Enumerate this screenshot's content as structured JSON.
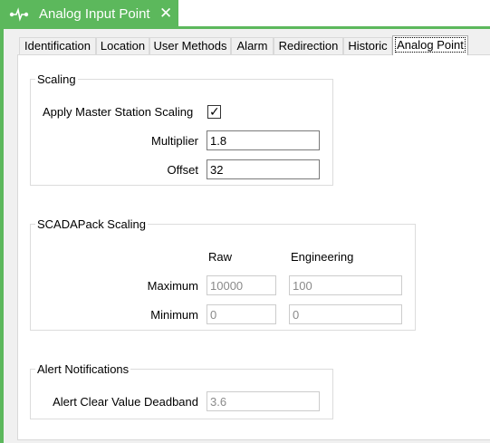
{
  "document_tab": {
    "title": "Analog Input Point",
    "close_glyph": "✕",
    "icon": "analog-signal-icon"
  },
  "page_tabs": [
    {
      "label": "Identification",
      "active": false
    },
    {
      "label": "Location",
      "active": false
    },
    {
      "label": "User Methods",
      "active": false
    },
    {
      "label": "Alarm",
      "active": false
    },
    {
      "label": "Redirection",
      "active": false
    },
    {
      "label": "Historic",
      "active": false
    },
    {
      "label": "Analog Point",
      "active": true
    }
  ],
  "scaling": {
    "title": "Scaling",
    "apply_label": "Apply Master Station Scaling",
    "apply_checked": true,
    "check_glyph": "✓",
    "multiplier_label": "Multiplier",
    "multiplier_value": "1.8",
    "offset_label": "Offset",
    "offset_value": "32"
  },
  "scadapack": {
    "title": "SCADAPack Scaling",
    "col_raw": "Raw",
    "col_engineering": "Engineering",
    "maximum_label": "Maximum",
    "maximum_raw": "10000",
    "maximum_eng": "100",
    "minimum_label": "Minimum",
    "minimum_raw": "0",
    "minimum_eng": "0"
  },
  "alerts": {
    "title": "Alert Notifications",
    "deadband_label": "Alert Clear Value Deadband",
    "deadband_value": "3.6"
  },
  "colors": {
    "accent": "#5cb85c",
    "window_bg": "#f0f0f0",
    "panel_bg": "#ffffff"
  }
}
